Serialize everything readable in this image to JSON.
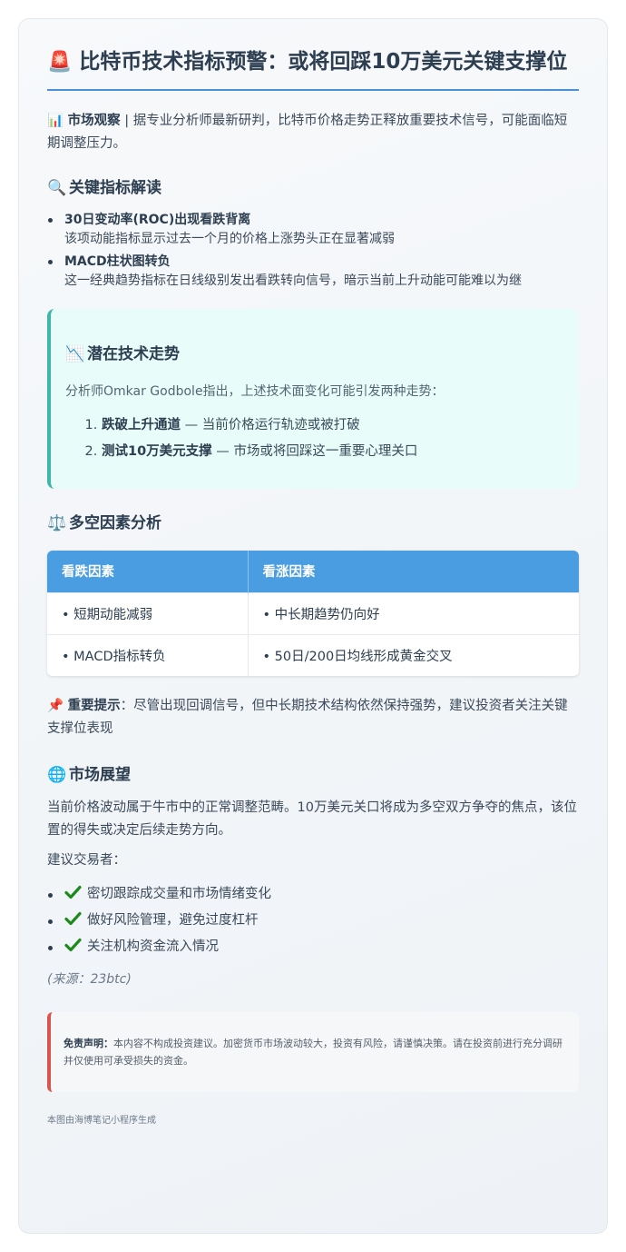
{
  "header": {
    "emoji": "🚨",
    "title": "比特币技术指标预警：或将回踩10万美元关键支撑位"
  },
  "intro": {
    "icon": "📊",
    "label": "市场观察",
    "separator": " | ",
    "text": "据专业分析师最新研判，比特币价格走势正释放重要技术信号，可能面临短期调整压力。"
  },
  "indicators": {
    "icon": "🔍",
    "heading": "关键指标解读",
    "items": [
      {
        "title": "30日变动率(ROC)出现看跌背离",
        "desc": "该项动能指标显示过去一个月的价格上涨势头正在显著减弱"
      },
      {
        "title": "MACD柱状图转负",
        "desc": "这一经典趋势指标在日线级别发出看跌转向信号，暗示当前上升动能可能难以为继"
      }
    ]
  },
  "trend": {
    "icon": "📉",
    "heading": "潜在技术走势",
    "lead": "分析师Omkar Godbole指出，上述技术面变化可能引发两种走势：",
    "items": [
      {
        "title": "跌破上升通道",
        "desc": " — 当前价格运行轨迹或被打破"
      },
      {
        "title": "测试10万美元支撑",
        "desc": " — 市场或将回踩这一重要心理关口"
      }
    ]
  },
  "factors": {
    "icon": "⚖️",
    "heading": "多空因素分析",
    "columns": [
      "看跌因素",
      "看涨因素"
    ],
    "rows": [
      [
        "• 短期动能减弱",
        "• 中长期趋势仍向好"
      ],
      [
        "• MACD指标转负",
        "• 50日/200日均线形成黄金交叉"
      ]
    ]
  },
  "note": {
    "icon": "📌",
    "label": "重要提示",
    "text": "：尽管出现回调信号，但中长期技术结构依然保持强势，建议投资者关注关键支撑位表现"
  },
  "outlook": {
    "icon": "🌐",
    "heading": "市场展望",
    "paragraph": "当前价格波动属于牛市中的正常调整范畴。10万美元关口将成为多空双方争夺的焦点，该位置的得失或决定后续走势方向。",
    "advice_lead": "建议交易者：",
    "checks": [
      "密切跟踪成交量和市场情绪变化",
      "做好风险管理，避免过度杠杆",
      "关注机构资金流入情况"
    ],
    "source": "(来源：23btc)"
  },
  "disclaimer": {
    "label": "免责声明：",
    "text": "本内容不构成投资建议。加密货币市场波动较大，投资有风险，请谨慎决策。请在投资前进行充分调研并仅使用可承受损失的资金。"
  },
  "footer": {
    "text": "本图由海博笔记小程序生成"
  },
  "colors": {
    "accent": "#4a90d9",
    "table_header": "#4a9de1",
    "trend_border": "#3fb6a8",
    "disclaimer_border": "#d9534f",
    "check_green": "#1e8a1e"
  }
}
